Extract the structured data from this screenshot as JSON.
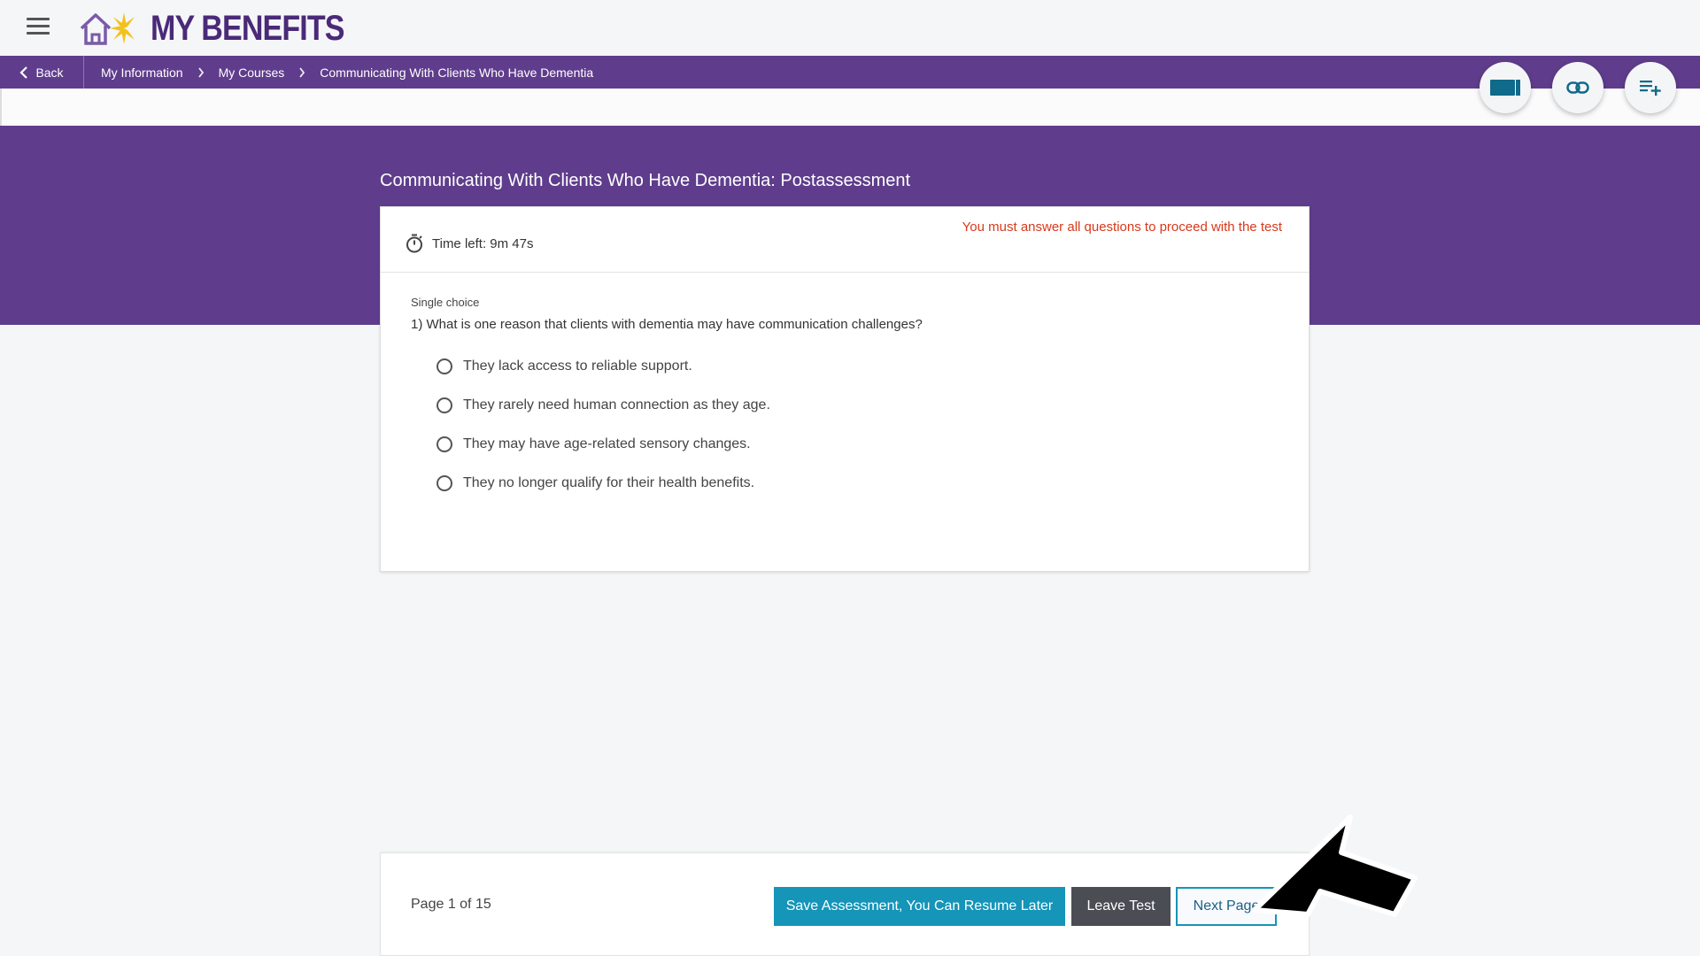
{
  "app": {
    "title": "MY BENEFITS",
    "brand_color": "#5f3d8c"
  },
  "header": {
    "menu_icon": "hamburger-icon",
    "logo_icon": "house-sun-icon"
  },
  "breadcrumb": {
    "back_label": "Back",
    "items": [
      "My Information",
      "My Courses",
      "Communicating With Clients Who Have Dementia"
    ]
  },
  "toolbar": {
    "buttons": [
      "video-icon",
      "link-icon",
      "playlist-add-icon"
    ]
  },
  "assessment": {
    "title": "Communicating With Clients Who Have Dementia: Postassessment",
    "timer_label": "Time left: 9m 47s",
    "warning": "You must answer all questions to proceed with the test",
    "question_type": "Single choice",
    "question": "1) What is one reason that clients with dementia may have communication challenges?",
    "options": [
      "They lack access to reliable support.",
      "They rarely need human connection as they age.",
      "They may have age-related sensory changes.",
      "They no longer qualify for their health benefits."
    ]
  },
  "footer": {
    "page_info": "Page 1 of 15",
    "save_label": "Save Assessment, You Can Resume Later",
    "leave_label": "Leave Test",
    "next_label": "Next Page"
  }
}
